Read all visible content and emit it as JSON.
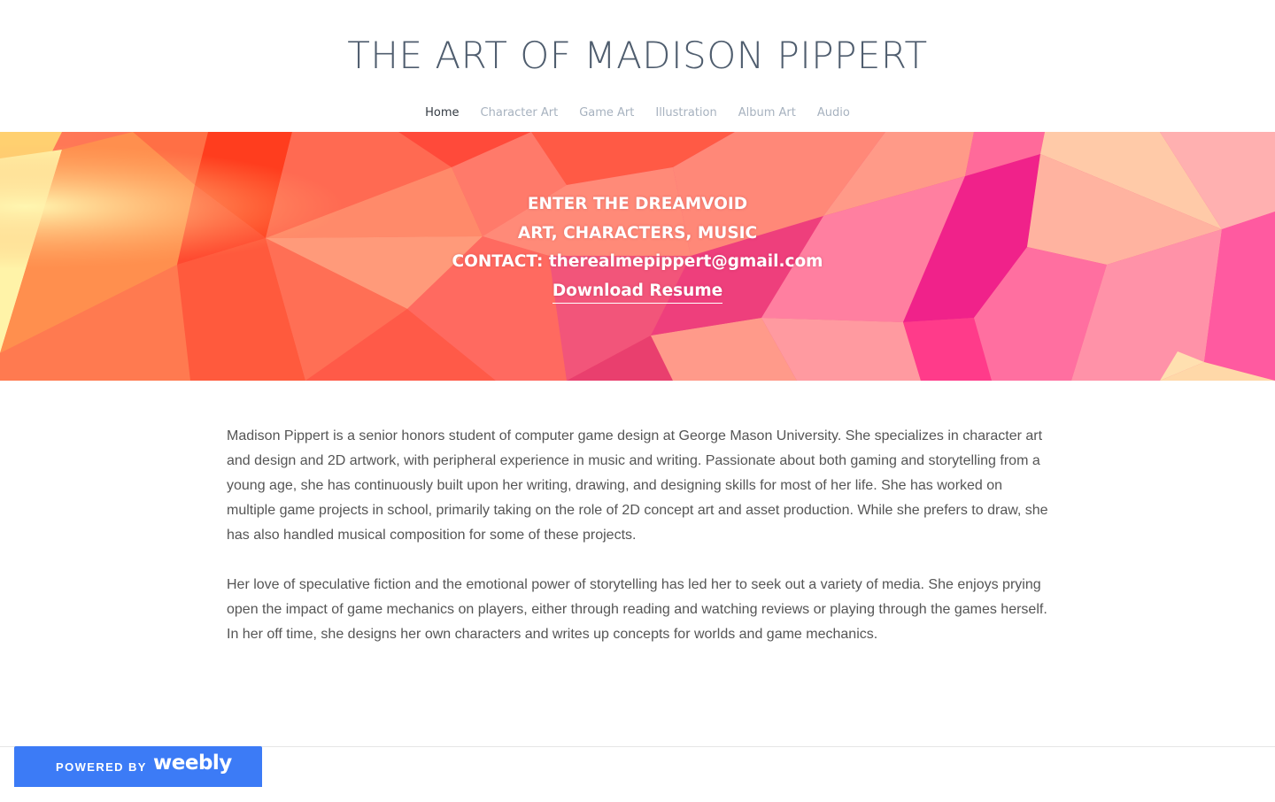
{
  "site": {
    "title": "THE ART OF MADISON PIPPERT"
  },
  "nav": {
    "items": [
      {
        "label": "Home",
        "active": true
      },
      {
        "label": "Character Art",
        "active": false
      },
      {
        "label": "Game Art",
        "active": false
      },
      {
        "label": "Illustration",
        "active": false
      },
      {
        "label": "Album Art",
        "active": false
      },
      {
        "label": "Audio",
        "active": false
      }
    ]
  },
  "hero": {
    "line1": "ENTER THE DREAMVOID",
    "line2": "ART, CHARACTERS, MUSIC",
    "line3": "CONTACT: therealmepippert@gmail.com",
    "link": "Download Resume"
  },
  "content": {
    "paragraph1": "Madison Pippert is a senior honors student of computer game design at George Mason University. She specializes in character art and design and 2D artwork, with peripheral experience in music and writing. Passionate about both gaming and storytelling from a young age, she has continuously built upon her writing, drawing, and designing skills for most of her life. She has worked on multiple game projects in school, primarily taking on the role of 2D concept art and asset production. While she prefers to draw, she has also handled musical composition for some of these projects.",
    "paragraph2": "Her love of speculative fiction and the emotional power of storytelling has led her to seek out a variety of media. She enjoys prying open the impact of game mechanics on players, either through reading and watching reviews or playing through the games herself. In her off time, she designs her own characters and writes up concepts for worlds and game mechanics."
  },
  "footer": {
    "powered_by": "POWERED BY",
    "brand": "weebly"
  },
  "colors": {
    "title": "#4f5d6e",
    "nav_active": "#333a42",
    "nav_inactive": "#a7b2bf",
    "body_text": "#555555",
    "weebly_blue": "#3c7bf6"
  }
}
